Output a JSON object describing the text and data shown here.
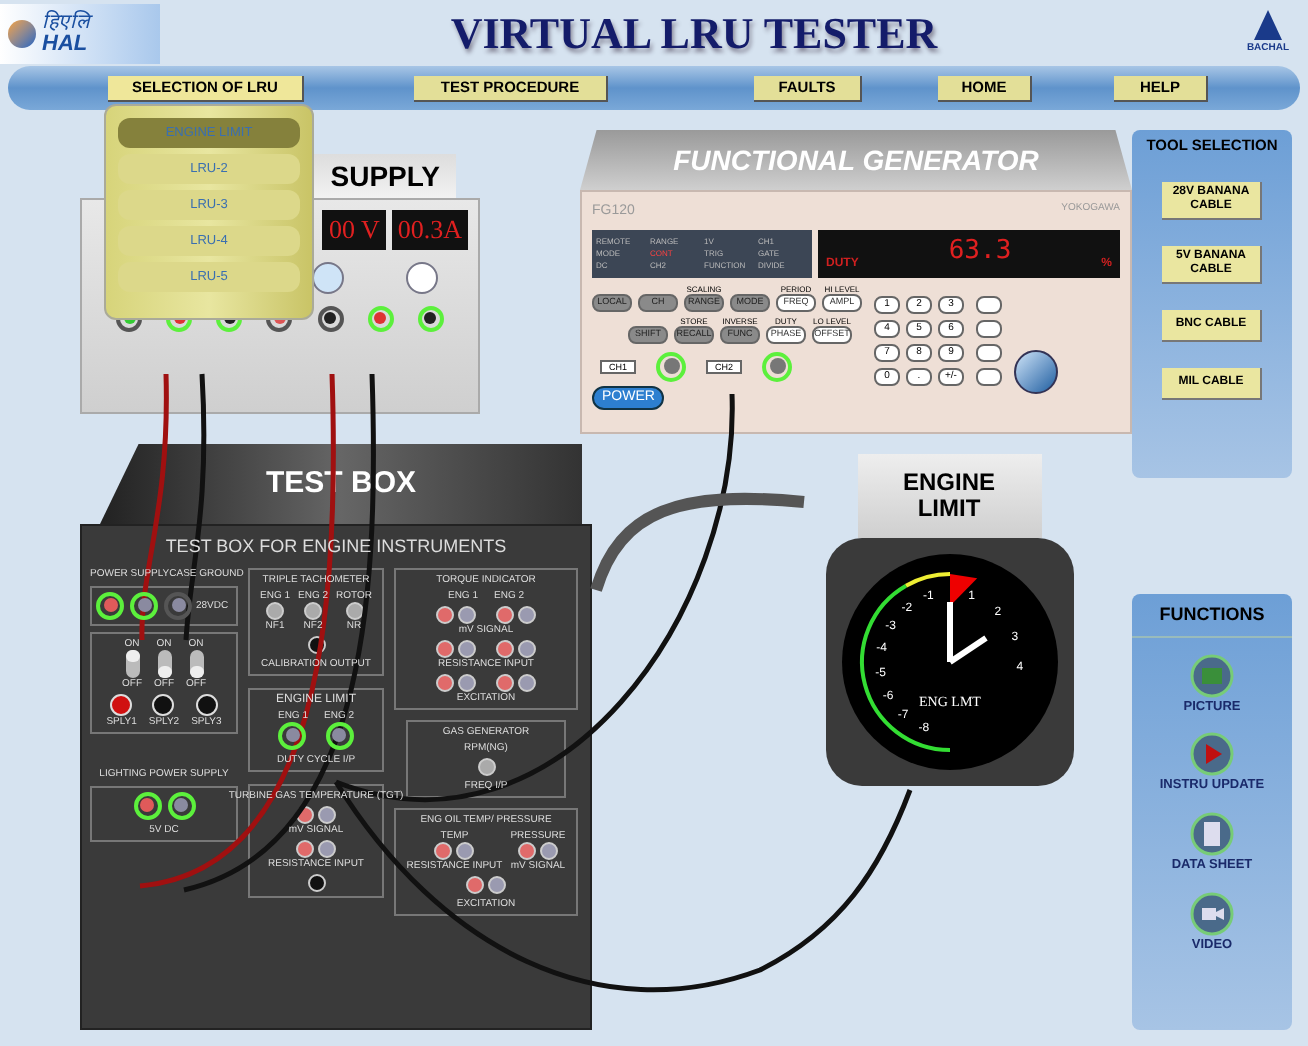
{
  "header": {
    "logo_script": "हिएलि",
    "logo_brand": "HAL",
    "title": "VIRTUAL LRU TESTER",
    "right_logo": "BACHAL"
  },
  "nav": [
    {
      "label": "SELECTION OF LRU",
      "expanded": true
    },
    {
      "label": "TEST PROCEDURE",
      "expanded": false
    },
    {
      "label": "FAULTS",
      "expanded": false
    },
    {
      "label": "HOME",
      "expanded": false
    },
    {
      "label": "HELP",
      "expanded": false
    }
  ],
  "lru_menu": [
    {
      "label": "ENGINE LIMIT",
      "selected": true
    },
    {
      "label": "LRU-2",
      "selected": false
    },
    {
      "label": "LRU-3",
      "selected": false
    },
    {
      "label": "LRU-4",
      "selected": false
    },
    {
      "label": "LRU-5",
      "selected": false
    }
  ],
  "power_supply": {
    "title": "SUPPLY",
    "voltage": "00 V",
    "current": "00.3A"
  },
  "function_generator": {
    "title": "FUNCTIONAL GENERATOR",
    "model": "FG120",
    "brand": "YOKOGAWA",
    "status": [
      "REMOTE",
      "RANGE",
      "1V",
      "CH1",
      "MODE",
      "CONT",
      "TRIG",
      "GATE",
      "DC",
      "CH2",
      "FUNCTION",
      "DIVIDE"
    ],
    "display_mode": "DUTY",
    "display_value": "63.3",
    "display_unit": "%",
    "key_rows": [
      [
        {
          "label": "LOCAL"
        },
        {
          "label": "CH"
        },
        {
          "label": "RANGE",
          "caption": "SCALING"
        },
        {
          "label": "MODE"
        },
        {
          "label": "FREQ",
          "caption": "PERIOD"
        },
        {
          "label": "AMPL",
          "caption": "HI LEVEL"
        }
      ],
      [
        {
          "label": "SHIFT"
        },
        {
          "label": "RECALL",
          "caption": "STORE"
        },
        {
          "label": "FUNC",
          "caption": "INVERSE"
        },
        {
          "label": "PHASE",
          "caption": "DUTY"
        },
        {
          "label": "OFFSET",
          "caption": "LO LEVEL"
        }
      ]
    ],
    "keypad": [
      "1",
      "2",
      "3",
      "4",
      "5",
      "6",
      "7",
      "8",
      "9",
      "0",
      ".",
      "+/-"
    ],
    "ch1": "CH1",
    "ch2": "CH2",
    "power": "POWER"
  },
  "test_box": {
    "title": "TEST BOX",
    "subtitle": "TEST BOX FOR ENGINE INSTRUMENTS",
    "power_labels": [
      "POWER SUPPLY",
      "CASE GROUND"
    ],
    "power_jacks": [
      {
        "color": "#e05a5a",
        "connected": true
      },
      {
        "color": "#8a8aa0",
        "connected": true
      },
      {
        "color": "#8a8aa0",
        "connected": false
      }
    ],
    "power_caption": "28VDC",
    "switches": [
      {
        "on_label": "ON",
        "off_label": "OFF",
        "on": true
      },
      {
        "on_label": "ON",
        "off_label": "OFF",
        "on": false
      },
      {
        "on_label": "ON",
        "off_label": "OFF",
        "on": false
      }
    ],
    "lamps": [
      {
        "label": "SPLY1",
        "lit": true
      },
      {
        "label": "SPLY2",
        "lit": false
      },
      {
        "label": "SPLY3",
        "lit": false
      }
    ],
    "lighting_label": "LIGHTING POWER SUPPLY",
    "lighting_jacks": [
      {
        "color": "#e05a5a",
        "connected": true
      },
      {
        "color": "#8a8aa0",
        "connected": true
      }
    ],
    "lighting_caption": "5V DC",
    "tacho": {
      "title": "TRIPLE TACHOMETER",
      "inputs": [
        {
          "top": "ENG 1",
          "bottom": "NF1"
        },
        {
          "top": "ENG 2",
          "bottom": "NF2"
        },
        {
          "top": "ROTOR",
          "bottom": "NR"
        }
      ],
      "output": "CALIBRATION OUTPUT"
    },
    "engine_limit": {
      "title": "ENGINE LIMIT",
      "inputs": [
        "ENG 1",
        "ENG 2"
      ],
      "caption": "DUTY CYCLE I/P"
    },
    "tgt": {
      "title": "TURBINE GAS TEMPERATURE (TGT)",
      "rows": [
        "mV SIGNAL",
        "RESISTANCE INPUT"
      ]
    },
    "torque": {
      "title": "TORQUE INDICATOR",
      "groups": [
        "ENG 1",
        "ENG 2"
      ],
      "rows": [
        "mV SIGNAL",
        "RESISTANCE INPUT",
        "EXCITATION"
      ]
    },
    "gas_generator": {
      "title": "GAS GENERATOR",
      "subtitle": "RPM(NG)",
      "caption": "FREQ I/P"
    },
    "oil": {
      "title": "ENG OIL TEMP/ PRESSURE",
      "groups": [
        "TEMP",
        "PRESSURE"
      ],
      "rows": [
        "RESISTANCE INPUT",
        "mV SIGNAL"
      ],
      "extra": "EXCITATION"
    }
  },
  "gauge": {
    "title": "ENGINE LIMIT",
    "dial_label": "ENG LMT",
    "left_numbers": [
      "-1",
      "-2",
      "-3",
      "-4",
      "-5",
      "-6",
      "-7",
      "-8"
    ],
    "right_numbers": [
      "1",
      "2",
      "3",
      "4"
    ]
  },
  "tool_selection": {
    "title": "TOOL SELECTION",
    "buttons": [
      "28V BANANA CABLE",
      "5V BANANA CABLE",
      "BNC CABLE",
      "MIL CABLE"
    ]
  },
  "functions": {
    "title": "FUNCTIONS",
    "items": [
      {
        "label": "PICTURE",
        "kind": "picture"
      },
      {
        "label": "INSTRU UPDATE",
        "kind": "play"
      },
      {
        "label": "DATA SHEET",
        "kind": "sheet"
      },
      {
        "label": "VIDEO",
        "kind": "video"
      }
    ]
  }
}
